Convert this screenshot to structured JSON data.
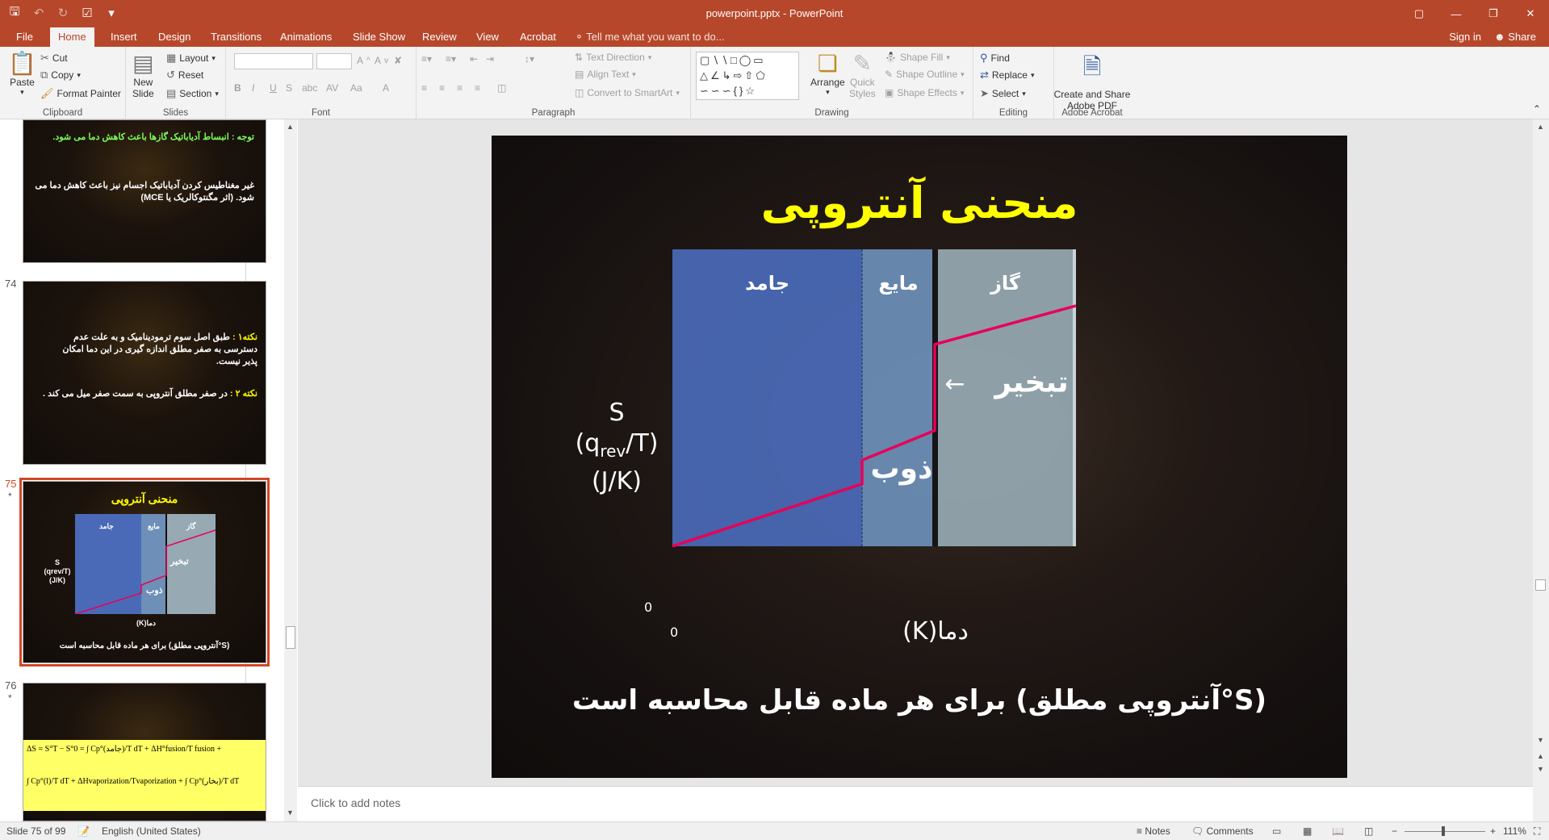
{
  "window": {
    "title": "powerpoint.pptx - PowerPoint",
    "quick_access": [
      "save-icon",
      "undo-icon",
      "redo-icon",
      "touch-mode-icon",
      "customize-icon"
    ],
    "controls": [
      "ribbon-display-icon",
      "minimize-icon",
      "restore-icon",
      "close-icon"
    ]
  },
  "tabs": {
    "items": [
      "File",
      "Home",
      "Insert",
      "Design",
      "Transitions",
      "Animations",
      "Slide Show",
      "Review",
      "View",
      "Acrobat"
    ],
    "active": "Home",
    "tell_me": "Tell me what you want to do...",
    "sign_in": "Sign in",
    "share": "Share"
  },
  "ribbon": {
    "clipboard": {
      "label": "Clipboard",
      "paste": "Paste",
      "cut": "Cut",
      "copy": "Copy",
      "format_painter": "Format Painter"
    },
    "slides": {
      "label": "Slides",
      "new_slide": "New",
      "new_slide2": "Slide",
      "layout": "Layout",
      "reset": "Reset",
      "section": "Section"
    },
    "font": {
      "label": "Font",
      "bold": "B",
      "italic": "I",
      "underline": "U",
      "strike": "S",
      "shadow": "abc",
      "spacing": "AV",
      "case": "Aa",
      "color": "A"
    },
    "paragraph": {
      "label": "Paragraph",
      "text_direction": "Text Direction",
      "align_text": "Align Text",
      "convert_smartart": "Convert to SmartArt"
    },
    "drawing": {
      "label": "Drawing",
      "arrange": "Arrange",
      "quick_styles": "Quick",
      "quick_styles2": "Styles",
      "shape_fill": "Shape Fill",
      "shape_outline": "Shape Outline",
      "shape_effects": "Shape Effects"
    },
    "editing": {
      "label": "Editing",
      "find": "Find",
      "replace": "Replace",
      "select": "Select"
    },
    "acrobat": {
      "label": "Adobe Acrobat",
      "create_share": "Create and Share",
      "adobe_pdf": "Adobe PDF"
    }
  },
  "thumbnails": {
    "slide73": {
      "line1": "توجه : انبساط آدیاباتیک گازها باعث کاهش دما می شود.",
      "line2": "غیر مغناطیس کردن آدیاباتیک اجسام نیز باعث کاهش دما می شود. (اثر مگنتوکالریک یا MCE)"
    },
    "slide74": {
      "number": "74",
      "line1_label": "نکته۱ :",
      "line1": "طبق اصل سوم ترمودینامیک و به علت عدم دسترسی به صفر مطلق اندازه گیری",
      "line1b": "در این دما امکان پذیر نیست.",
      "line2_label": "نکته ۲ :",
      "line2": "در صفر مطلق آنتروپی به سمت صفر میل می کند ."
    },
    "slide75": {
      "number": "75",
      "star": "*",
      "title": "منحنی آنتروپی",
      "solid": "جامد",
      "liquid": "مایع",
      "gas": "گاز",
      "vapor": "تبخیر",
      "fusion": "ذوب",
      "s": "S",
      "qrev": "(qrev/T)",
      "jk": "(J/K)",
      "xlabel": "دما(K)",
      "zero": "0",
      "footer": "(S°آنتروپی مطلق) برای هر ماده قابل محاسبه است"
    },
    "slide76": {
      "number": "76",
      "star": "*",
      "formula1": "ΔS = S°T − S°0 = ∫ Cp°(جامد)/T dT + ΔH°fusion/T fusion +",
      "formula2": "∫ Cp°(l)/T dT + ΔHvaporization/Tvaporization + ∫ Cp°(بخار)/T dT"
    }
  },
  "slide": {
    "title": "منحنی آنتروپی",
    "ylabel_s": "S",
    "ylabel_q": "(q",
    "ylabel_sub": "rev",
    "ylabel_t": "/T)",
    "ylabel_units": "(J/K)",
    "xlabel": "دما(K)",
    "origin_y": "0",
    "origin_x": "0",
    "footer": "(S°آنتروپی مطلق) برای هر ماده قابل محاسبه است",
    "notes_placeholder": "Click to add notes"
  },
  "chart_data": {
    "type": "line",
    "title": "منحنی آنتروپی",
    "xlabel": "دما(K)",
    "ylabel": "S (qrev/T) (J/K)",
    "regions": [
      {
        "name": "جامد",
        "color": "#4a6ab8"
      },
      {
        "name": "مایع",
        "color": "#6d8fb8"
      },
      {
        "name": "گاز",
        "color": "#97a9b3"
      }
    ],
    "annotations": [
      "ذوب",
      "تبخیر",
      "←"
    ],
    "series": [
      {
        "values_note": "",
        "color": "#e8005a",
        "points": [
          [
            0,
            0
          ],
          [
            0.47,
            0.21
          ],
          [
            0.47,
            0.29
          ],
          [
            0.65,
            0.39
          ],
          [
            0.65,
            0.68
          ],
          [
            1.0,
            0.81
          ]
        ]
      }
    ],
    "xlim": [
      0,
      1
    ],
    "ylim": [
      0,
      1
    ],
    "tick_labels": [
      "0"
    ]
  },
  "status": {
    "slide_of": "Slide 75 of 99",
    "language": "English (United States)",
    "notes": "Notes",
    "comments": "Comments",
    "zoom": "111%"
  },
  "colors": {
    "accent": "#b7472a",
    "title_yellow": "#ffff00",
    "curve": "#e8005a"
  }
}
